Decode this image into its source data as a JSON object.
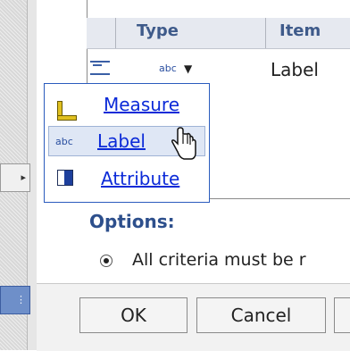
{
  "table": {
    "headers": [
      "Type",
      "Item"
    ],
    "row": {
      "type_value": "abc",
      "item_value": "Label"
    }
  },
  "type_menu": {
    "items": [
      {
        "label": "Measure",
        "icon": "ruler-icon",
        "selected": false
      },
      {
        "label": "Label",
        "icon": "abc",
        "selected": true
      },
      {
        "label": "Attribute",
        "icon": "attribute-icon",
        "selected": false
      }
    ]
  },
  "options": {
    "title": "Options:",
    "criteria_text": "All criteria must be r",
    "criteria_selected": true
  },
  "buttons": {
    "ok": "OK",
    "cancel": "Cancel"
  },
  "colors": {
    "link": "#0b2ad8",
    "header_text": "#3e5a8a",
    "accent": "#2a5bbd"
  }
}
